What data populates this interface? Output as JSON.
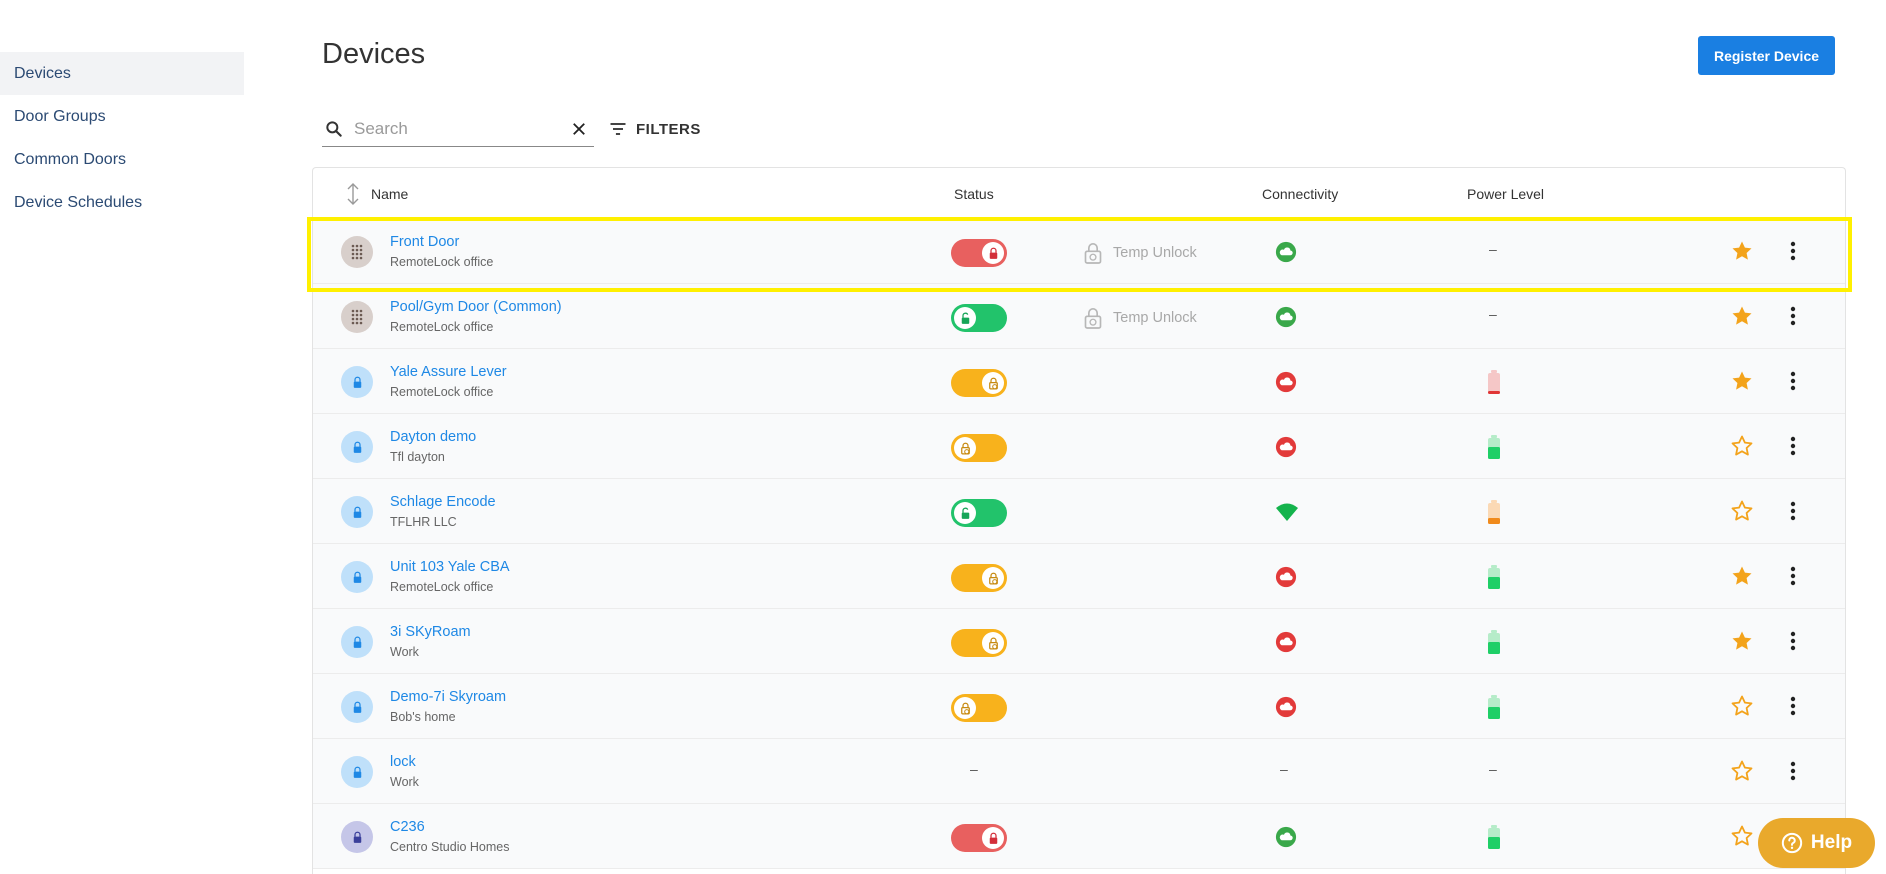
{
  "sidebar": {
    "items": [
      {
        "label": "Devices",
        "active": true
      },
      {
        "label": "Door Groups"
      },
      {
        "label": "Common Doors"
      },
      {
        "label": "Device Schedules"
      }
    ]
  },
  "header": {
    "title": "Devices",
    "register_label": "Register Device"
  },
  "search": {
    "placeholder": "Search",
    "value": ""
  },
  "filters": {
    "label": "FILTERS"
  },
  "table": {
    "columns": {
      "name": "Name",
      "status": "Status",
      "connectivity": "Connectivity",
      "power": "Power Level"
    },
    "temp_unlock_label": "Temp Unlock",
    "dash": "–",
    "rows": [
      {
        "name": "Front Door",
        "location": "RemoteLock office",
        "avatar": "keypad",
        "status": "red-locked",
        "temp_unlock": true,
        "connectivity": "cloud-green",
        "power": "none",
        "favorite": true
      },
      {
        "name": "Pool/Gym Door (Common)",
        "location": "RemoteLock office",
        "avatar": "keypad",
        "status": "green-unlocked",
        "temp_unlock": true,
        "connectivity": "cloud-green",
        "power": "none",
        "favorite": true
      },
      {
        "name": "Yale Assure Lever",
        "location": "RemoteLock office",
        "avatar": "lock",
        "status": "yellow-right",
        "temp_unlock": false,
        "connectivity": "cloud-red",
        "power": "low",
        "favorite": true
      },
      {
        "name": "Dayton demo",
        "location": "Tfl dayton",
        "avatar": "lock",
        "status": "yellow-left",
        "temp_unlock": false,
        "connectivity": "cloud-red",
        "power": "full",
        "favorite": false
      },
      {
        "name": "Schlage Encode",
        "location": "TFLHR LLC",
        "avatar": "lock",
        "status": "green-unlocked",
        "temp_unlock": false,
        "connectivity": "wifi-green",
        "power": "medium",
        "favorite": false
      },
      {
        "name": "Unit 103 Yale CBA",
        "location": "RemoteLock office",
        "avatar": "lock",
        "status": "yellow-right",
        "temp_unlock": false,
        "connectivity": "cloud-red",
        "power": "full",
        "favorite": true
      },
      {
        "name": "3i SKyRoam",
        "location": "Work",
        "avatar": "lock",
        "status": "yellow-right",
        "temp_unlock": false,
        "connectivity": "cloud-red",
        "power": "full",
        "favorite": true
      },
      {
        "name": "Demo-7i Skyroam",
        "location": "Bob's home",
        "avatar": "lock",
        "status": "yellow-left",
        "temp_unlock": false,
        "connectivity": "cloud-red",
        "power": "full",
        "favorite": false
      },
      {
        "name": "lock",
        "location": "Work",
        "avatar": "lock",
        "status": "none",
        "temp_unlock": false,
        "connectivity": "none",
        "power": "none",
        "favorite": false
      },
      {
        "name": "C236",
        "location": "Centro Studio Homes",
        "avatar": "lock-dark",
        "status": "red-locked",
        "temp_unlock": false,
        "connectivity": "cloud-green",
        "power": "full",
        "favorite": false
      }
    ]
  },
  "help": {
    "label": "Help"
  },
  "colors": {
    "accent": "#1a7fe2",
    "link": "#1e88e5",
    "green": "#22c36b",
    "red": "#e8605f",
    "yellow": "#f8b21c",
    "star": "#f3a31b",
    "highlight": "#fff000"
  }
}
